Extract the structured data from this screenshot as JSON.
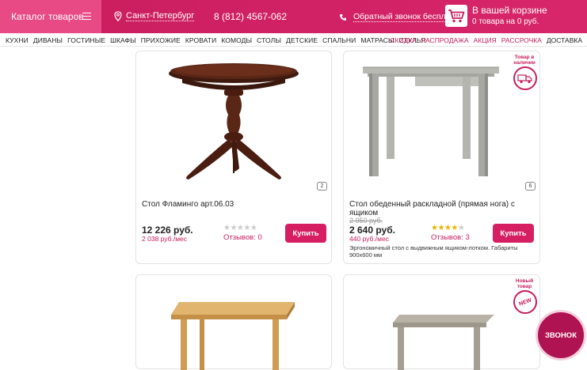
{
  "header": {
    "catalog_label": "Каталог товаров",
    "city": "Санкт-Петербург",
    "phone": "8 (812) 4567-062",
    "callback": "Обратный звонок бесплатно",
    "cart_title": "В вашей корзине",
    "cart_sub": "0 товара на 0 руб."
  },
  "menu": {
    "left": [
      "КУХНИ",
      "ДИВАНЫ",
      "ГОСТИНЫЕ",
      "ШКАФЫ",
      "ПРИХОЖИЕ",
      "КРОВАТИ",
      "КОМОДЫ",
      "СТОЛЫ",
      "ДЕТСКИЕ",
      "СПАЛЬНИ",
      "МАТРАСЫ",
      "СТУЛЬЯ"
    ],
    "right": [
      "СКИДКА",
      "РАСПРОДАЖА",
      "АКЦИЯ",
      "РАССРОЧКА",
      "ДОСТАВКА"
    ]
  },
  "products": [
    {
      "title": "Стол Фламинго арт.06.03",
      "price": "12 226 руб.",
      "monthly": "2 038 руб./мес",
      "reviews": "Отзывов: 0",
      "rating": 0,
      "buy": "Купить",
      "image_count": "2"
    },
    {
      "title": "Стол обеденный раскладной (прямая нога) с ящиком",
      "old_price": "2 950 руб.",
      "price": "2 640 руб.",
      "monthly": "440 руб./мес",
      "reviews": "Отзывов: 3",
      "rating": 4,
      "buy": "Купить",
      "image_count": "6",
      "desc": "Эргономичный стол с выдвижным ящиком-лотком. Габариты 900х600 мм",
      "tag": "Товар в наличии"
    },
    {
      "title": "",
      "tag": ""
    },
    {
      "title": "",
      "tag": "Новый товар",
      "tag_icon": "NEW"
    }
  ],
  "callback_button": "ЗВОНОК",
  "colors": {
    "brand": "#c81d5e",
    "star_on": "#e8b600",
    "star_off": "#cccccc"
  }
}
